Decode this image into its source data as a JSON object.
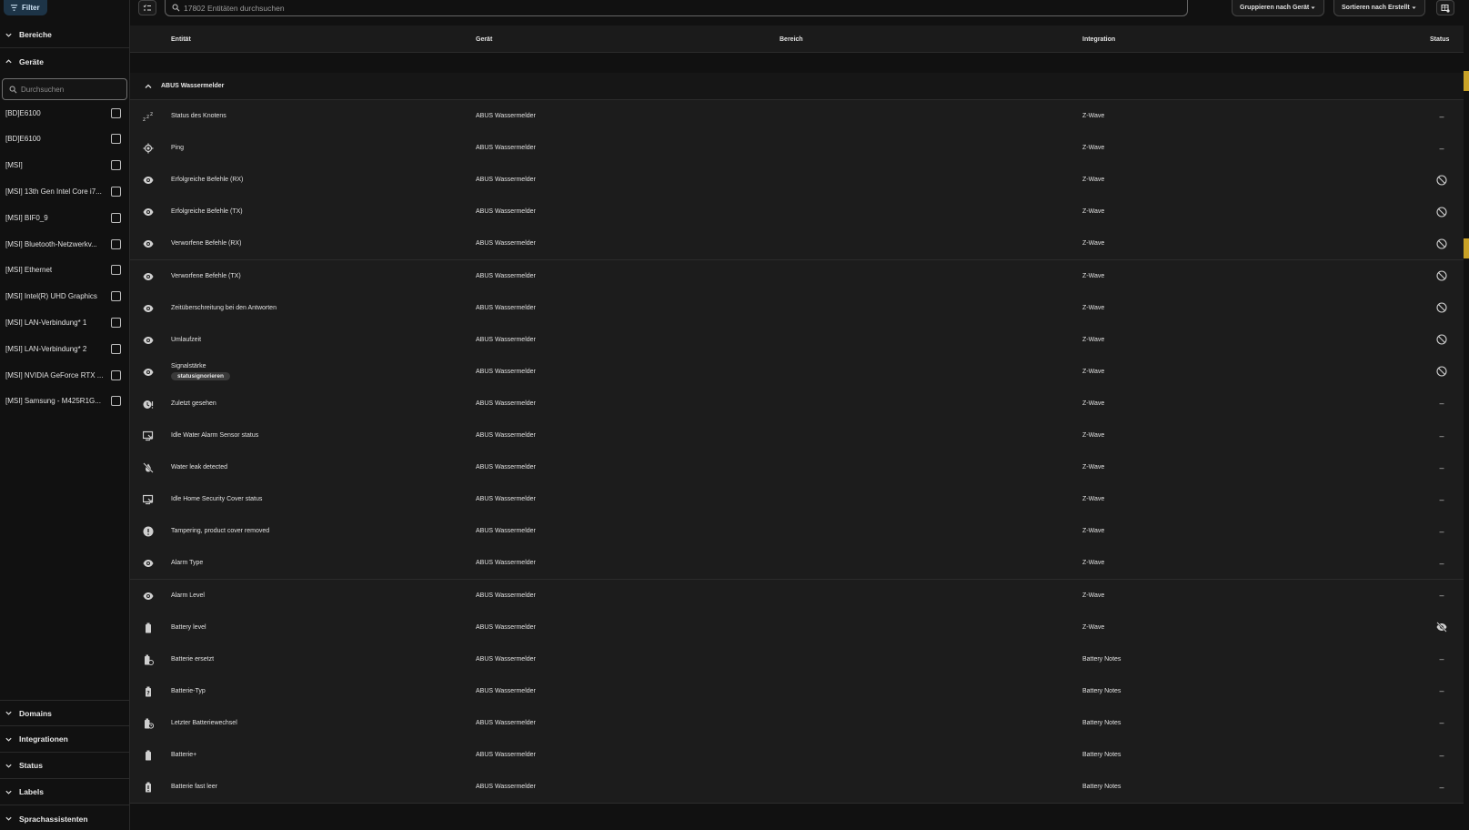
{
  "sidebar": {
    "filter_label": "Filter",
    "sections": {
      "bereiche": "Bereiche",
      "geraete": "Geräte",
      "domains": "Domains",
      "integrationen": "Integrationen",
      "status": "Status",
      "labels": "Labels",
      "sprachassistenten": "Sprachassistenten"
    },
    "search_placeholder": "Durchsuchen",
    "devices": [
      "[BD]E6100",
      "[BD]E6100",
      "[MSI]",
      "[MSI] 13th Gen Intel Core i7...",
      "[MSI] BIF0_9",
      "[MSI] Bluetooth-Netzwerkv...",
      "[MSI] Ethernet",
      "[MSI] Intel(R) UHD Graphics",
      "[MSI] LAN-Verbindung* 1",
      "[MSI] LAN-Verbindung* 2",
      "[MSI] NVIDIA GeForce RTX ...",
      "[MSI] Samsung - M425R1G..."
    ]
  },
  "toolbar": {
    "search_placeholder": "17802 Entitäten durchsuchen",
    "group_by": "Gruppieren nach Gerät",
    "sort_by": "Sortieren nach Erstellt"
  },
  "table": {
    "headers": {
      "entity": "Entität",
      "device": "Gerät",
      "area": "Bereich",
      "integration": "Integration",
      "status": "Status"
    },
    "group_label": "ABUS Wassermelder",
    "rows": [
      {
        "icon": "sleep-icon",
        "name": "Status des Knotens",
        "device": "ABUS Wassermelder",
        "integration": "Z-Wave",
        "status": "–"
      },
      {
        "icon": "crosshairs-icon",
        "name": "Ping",
        "device": "ABUS Wassermelder",
        "integration": "Z-Wave",
        "status": "–"
      },
      {
        "icon": "eye-icon",
        "name": "Erfolgreiche Befehle (RX)",
        "device": "ABUS Wassermelder",
        "integration": "Z-Wave",
        "status": "disabled-icon"
      },
      {
        "icon": "eye-icon",
        "name": "Erfolgreiche Befehle (TX)",
        "device": "ABUS Wassermelder",
        "integration": "Z-Wave",
        "status": "disabled-icon"
      },
      {
        "icon": "eye-icon",
        "name": "Verworfene Befehle (RX)",
        "device": "ABUS Wassermelder",
        "integration": "Z-Wave",
        "status": "disabled-icon"
      },
      {
        "icon": "eye-icon",
        "name": "Verworfene Befehle (TX)",
        "device": "ABUS Wassermelder",
        "integration": "Z-Wave",
        "status": "disabled-icon"
      },
      {
        "icon": "eye-icon",
        "name": "Zeitüberschreitung bei den Antworten",
        "device": "ABUS Wassermelder",
        "integration": "Z-Wave",
        "status": "disabled-icon"
      },
      {
        "icon": "eye-icon",
        "name": "Umlaufzeit",
        "device": "ABUS Wassermelder",
        "integration": "Z-Wave",
        "status": "disabled-icon"
      },
      {
        "icon": "eye-icon",
        "name": "Signalstärke",
        "chip": "statusignorieren",
        "device": "ABUS Wassermelder",
        "integration": "Z-Wave",
        "status": "disabled-icon"
      },
      {
        "icon": "clock-alert-icon",
        "name": "Zuletzt gesehen",
        "device": "ABUS Wassermelder",
        "integration": "Z-Wave",
        "status": "–"
      },
      {
        "icon": "monitor-arrow-icon",
        "name": "Idle Water Alarm Sensor status",
        "device": "ABUS Wassermelder",
        "integration": "Z-Wave",
        "status": "–"
      },
      {
        "icon": "water-off-icon",
        "name": "Water leak detected",
        "device": "ABUS Wassermelder",
        "integration": "Z-Wave",
        "status": "–"
      },
      {
        "icon": "monitor-arrow-icon",
        "name": "Idle Home Security Cover status",
        "device": "ABUS Wassermelder",
        "integration": "Z-Wave",
        "status": "–"
      },
      {
        "icon": "alert-circle-icon",
        "name": "Tampering, product cover removed",
        "device": "ABUS Wassermelder",
        "integration": "Z-Wave",
        "status": "–"
      },
      {
        "icon": "eye-icon",
        "name": "Alarm Type",
        "device": "ABUS Wassermelder",
        "integration": "Z-Wave",
        "status": "–"
      },
      {
        "icon": "eye-icon",
        "name": "Alarm Level",
        "device": "ABUS Wassermelder",
        "integration": "Z-Wave",
        "status": "–"
      },
      {
        "icon": "battery-icon",
        "name": "Battery level",
        "device": "ABUS Wassermelder",
        "integration": "Z-Wave",
        "status": "hidden-icon"
      },
      {
        "icon": "battery-sync-icon",
        "name": "Batterie ersetzt",
        "device": "ABUS Wassermelder",
        "integration": "Battery Notes",
        "status": "–"
      },
      {
        "icon": "battery-unknown-icon",
        "name": "Batterie-Typ",
        "device": "ABUS Wassermelder",
        "integration": "Battery Notes",
        "status": "–"
      },
      {
        "icon": "battery-clock-icon",
        "name": "Letzter Batteriewechsel",
        "device": "ABUS Wassermelder",
        "integration": "Battery Notes",
        "status": "–"
      },
      {
        "icon": "battery-icon",
        "name": "Batterie+",
        "device": "ABUS Wassermelder",
        "integration": "Battery Notes",
        "status": "–"
      },
      {
        "icon": "battery-alert-icon",
        "name": "Batterie fast leer",
        "device": "ABUS Wassermelder",
        "integration": "Battery Notes",
        "status": "–"
      }
    ]
  }
}
